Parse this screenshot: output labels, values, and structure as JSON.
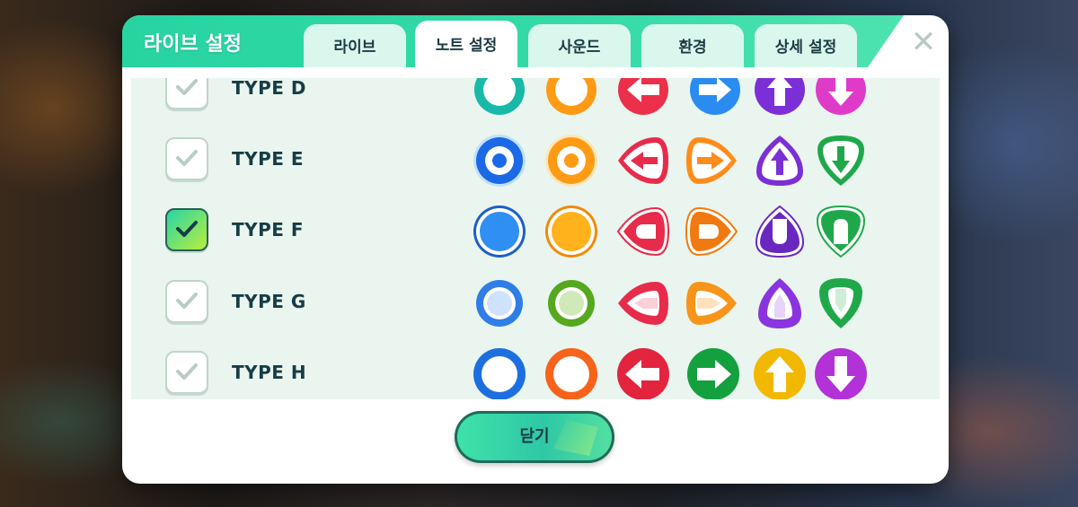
{
  "dialog": {
    "title": "라이브 설정",
    "close_icon": "close-x-icon",
    "accent": "#2ed6a3"
  },
  "tabs": [
    {
      "label": "라이브",
      "active": false
    },
    {
      "label": "노트 설정",
      "active": true
    },
    {
      "label": "사운드",
      "active": false
    },
    {
      "label": "환경",
      "active": false
    },
    {
      "label": "상세 설정",
      "active": false
    }
  ],
  "note_types": [
    {
      "label": "TYPE D",
      "checked": false,
      "notes": [
        "teal-ring-note-icon",
        "orange-ring-note-icon",
        "red-left-arrow-note-icon",
        "blue-right-arrow-note-icon",
        "purple-up-arrow-note-icon",
        "pink-down-arrow-note-icon"
      ]
    },
    {
      "label": "TYPE E",
      "checked": false,
      "notes": [
        "blue-target-note-icon",
        "orange-target-note-icon",
        "red-left-arrow-drop-icon",
        "orange-right-arrow-drop-icon",
        "purple-up-arrow-drop-icon",
        "green-down-arrow-drop-icon"
      ]
    },
    {
      "label": "TYPE F",
      "checked": true,
      "notes": [
        "blue-solid-circle-note-icon",
        "orange-solid-circle-note-icon",
        "red-left-c-drop-icon",
        "orange-right-c-drop-icon",
        "purple-up-u-drop-icon",
        "green-down-n-drop-icon"
      ]
    },
    {
      "label": "TYPE G",
      "checked": false,
      "notes": [
        "blue-dot-note-icon",
        "green-dot-note-icon",
        "red-left-hollow-drop-icon",
        "orange-right-hollow-drop-icon",
        "purple-up-hollow-drop-icon",
        "green-down-hollow-drop-icon"
      ]
    },
    {
      "label": "TYPE H",
      "checked": false,
      "notes": [
        "blue-ring-note-icon",
        "orange-ring-note-icon",
        "red-left-arrow-note-icon",
        "green-right-arrow-note-icon",
        "yellow-up-arrow-note-icon",
        "purple-down-arrow-note-icon"
      ]
    }
  ],
  "footer": {
    "close_label": "닫기"
  }
}
